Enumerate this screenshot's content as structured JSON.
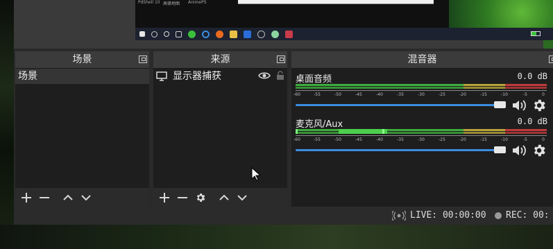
{
  "preview": {
    "label_left": "PdShell 10",
    "label_mid": "高德地图",
    "label_right": "AnimePS"
  },
  "panels": {
    "scenes": {
      "title": "场景",
      "items": [
        "场景"
      ]
    },
    "sources": {
      "title": "来源",
      "items": [
        {
          "label": "显示器捕获",
          "icon": "monitor-icon"
        }
      ]
    },
    "mixer": {
      "title": "混音器",
      "channels": [
        {
          "name": "桌面音频",
          "db": "0.0 dB",
          "volume_fraction": 0.97
        },
        {
          "name": "麦克风/Aux",
          "db": "0.0 dB",
          "volume_fraction": 0.97
        }
      ],
      "ticks": [
        "-60",
        "-55",
        "-50",
        "-45",
        "-40",
        "-35",
        "-30",
        "-25",
        "-20",
        "-15",
        "-10",
        "-5",
        "0"
      ]
    }
  },
  "status": {
    "live": "LIVE: 00:00:00",
    "rec": "REC: 00:"
  },
  "colors": {
    "meter_green": "#3fae3f",
    "meter_yellow": "#b8a53a",
    "meter_red": "#c23a3a",
    "slider_blue": "#3a8de0"
  }
}
